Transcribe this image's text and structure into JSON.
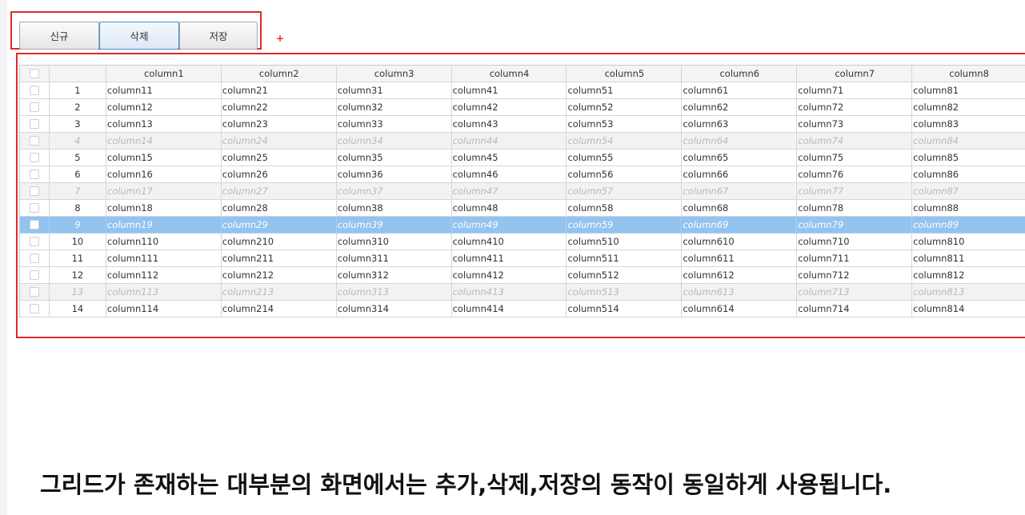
{
  "toolbar": {
    "new_label": "신규",
    "delete_label": "삭제",
    "save_label": "저장",
    "marker": "+"
  },
  "grid": {
    "columns": [
      "column1",
      "column2",
      "column3",
      "column4",
      "column5",
      "column6",
      "column7",
      "column8"
    ],
    "rows": [
      {
        "num": "1",
        "state": "normal",
        "cells": [
          "column11",
          "column21",
          "column31",
          "column41",
          "column51",
          "column61",
          "column71",
          "column81"
        ]
      },
      {
        "num": "2",
        "state": "normal",
        "cells": [
          "column12",
          "column22",
          "column32",
          "column42",
          "column52",
          "column62",
          "column72",
          "column82"
        ]
      },
      {
        "num": "3",
        "state": "normal",
        "cells": [
          "column13",
          "column23",
          "column33",
          "column43",
          "column53",
          "column63",
          "column73",
          "column83"
        ]
      },
      {
        "num": "4",
        "state": "disabled",
        "cells": [
          "column14",
          "column24",
          "column34",
          "column44",
          "column54",
          "column64",
          "column74",
          "column84"
        ]
      },
      {
        "num": "5",
        "state": "normal",
        "cells": [
          "column15",
          "column25",
          "column35",
          "column45",
          "column55",
          "column65",
          "column75",
          "column85"
        ]
      },
      {
        "num": "6",
        "state": "normal",
        "cells": [
          "column16",
          "column26",
          "column36",
          "column46",
          "column56",
          "column66",
          "column76",
          "column86"
        ]
      },
      {
        "num": "7",
        "state": "disabled",
        "cells": [
          "column17",
          "column27",
          "column37",
          "column47",
          "column57",
          "column67",
          "column77",
          "column87"
        ]
      },
      {
        "num": "8",
        "state": "normal",
        "cells": [
          "column18",
          "column28",
          "column38",
          "column48",
          "column58",
          "column68",
          "column78",
          "column88"
        ]
      },
      {
        "num": "9",
        "state": "selected",
        "cells": [
          "column19",
          "column29",
          "column39",
          "column49",
          "column59",
          "column69",
          "column79",
          "column89"
        ]
      },
      {
        "num": "10",
        "state": "normal",
        "cells": [
          "column110",
          "column210",
          "column310",
          "column410",
          "column510",
          "column610",
          "column710",
          "column810"
        ]
      },
      {
        "num": "11",
        "state": "normal",
        "cells": [
          "column111",
          "column211",
          "column311",
          "column411",
          "column511",
          "column611",
          "column711",
          "column811"
        ]
      },
      {
        "num": "12",
        "state": "normal",
        "cells": [
          "column112",
          "column212",
          "column312",
          "column412",
          "column512",
          "column612",
          "column712",
          "column812"
        ]
      },
      {
        "num": "13",
        "state": "disabled",
        "cells": [
          "column113",
          "column213",
          "column313",
          "column413",
          "column513",
          "column613",
          "column713",
          "column813"
        ]
      },
      {
        "num": "14",
        "state": "normal",
        "cells": [
          "column114",
          "column214",
          "column314",
          "column414",
          "column514",
          "column614",
          "column714",
          "column814"
        ]
      }
    ]
  },
  "caption": "그리드가 존재하는 대부분의 화면에서는 추가,삭제,저장의 동작이 동일하게 사용됩니다."
}
